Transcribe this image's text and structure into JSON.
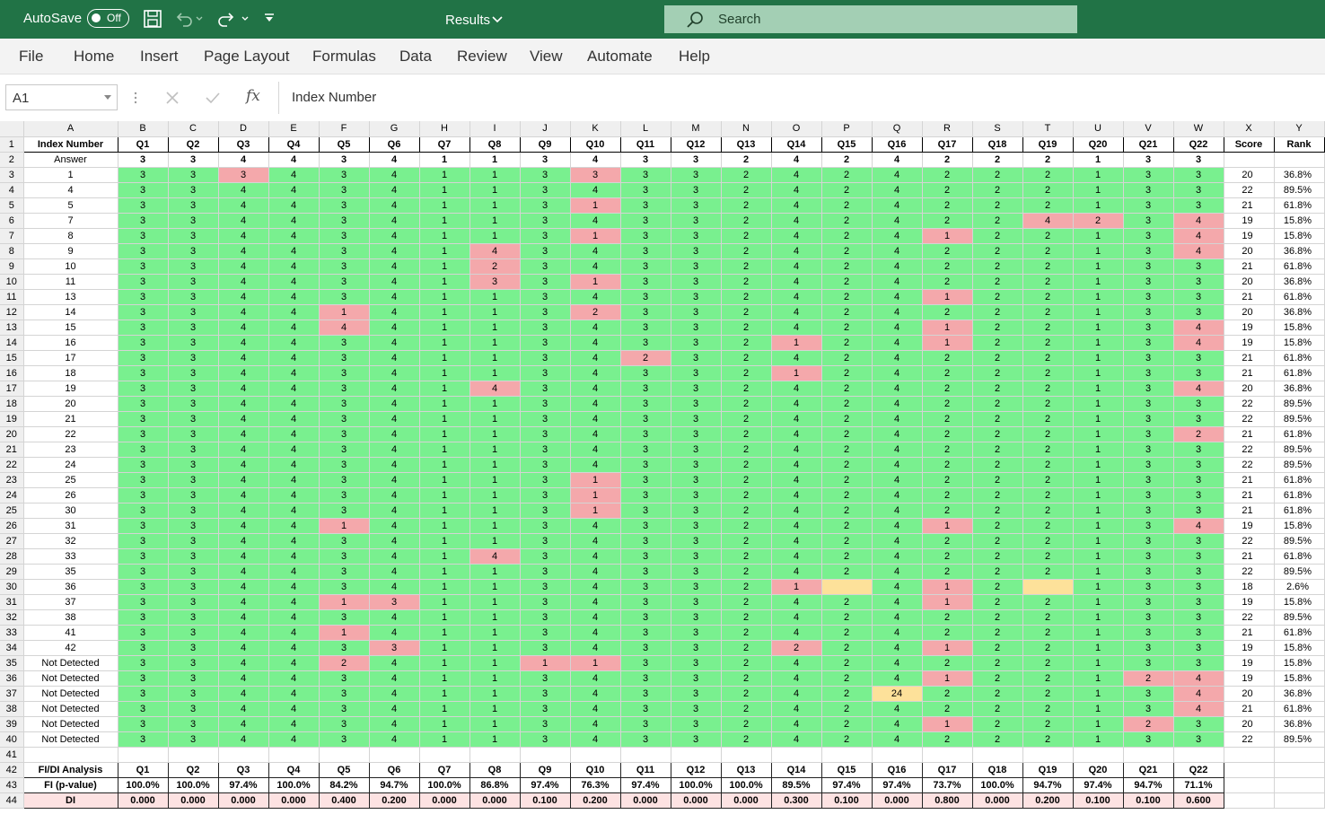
{
  "titlebar": {
    "autosave": "AutoSave",
    "toggle": "Off",
    "title": "Results",
    "search": "Search"
  },
  "ribbon": [
    "File",
    "Home",
    "Insert",
    "Page Layout",
    "Formulas",
    "Data",
    "Review",
    "View",
    "Automate",
    "Help"
  ],
  "formula": {
    "cell": "A1",
    "value": "Index Number"
  },
  "columns": [
    "A",
    "B",
    "C",
    "D",
    "E",
    "F",
    "G",
    "H",
    "I",
    "J",
    "K",
    "L",
    "M",
    "N",
    "O",
    "P",
    "Q",
    "R",
    "S",
    "T",
    "U",
    "V",
    "W",
    "X",
    "Y"
  ],
  "header": [
    "Index Number",
    "Q1",
    "Q2",
    "Q3",
    "Q4",
    "Q5",
    "Q6",
    "Q7",
    "Q8",
    "Q9",
    "Q10",
    "Q11",
    "Q12",
    "Q13",
    "Q14",
    "Q15",
    "Q16",
    "Q17",
    "Q18",
    "Q19",
    "Q20",
    "Q21",
    "Q22",
    "Score",
    "Rank"
  ],
  "answer": [
    "Answer",
    "3",
    "3",
    "4",
    "4",
    "3",
    "4",
    "1",
    "1",
    "3",
    "4",
    "3",
    "3",
    "2",
    "4",
    "2",
    "4",
    "2",
    "2",
    "2",
    "1",
    "3",
    "3"
  ],
  "students": [
    {
      "id": "1",
      "d": "3,3,3,4,3,4,1,1,3,3,3,3,2,4,2,4,2,2,2,1,3,3",
      "score": "20",
      "rank": "36.8%"
    },
    {
      "id": "4",
      "d": "3,3,4,4,3,4,1,1,3,4,3,3,2,4,2,4,2,2,2,1,3,3",
      "score": "22",
      "rank": "89.5%"
    },
    {
      "id": "5",
      "d": "3,3,4,4,3,4,1,1,3,1,3,3,2,4,2,4,2,2,2,1,3,3",
      "score": "21",
      "rank": "61.8%"
    },
    {
      "id": "7",
      "d": "3,3,4,4,3,4,1,1,3,4,3,3,2,4,2,4,2,2,4,2,3,4",
      "score": "19",
      "rank": "15.8%"
    },
    {
      "id": "8",
      "d": "3,3,4,4,3,4,1,1,3,1,3,3,2,4,2,4,1,2,2,1,3,4",
      "score": "19",
      "rank": "15.8%"
    },
    {
      "id": "9",
      "d": "3,3,4,4,3,4,1,4,3,4,3,3,2,4,2,4,2,2,2,1,3,4",
      "score": "20",
      "rank": "36.8%"
    },
    {
      "id": "10",
      "d": "3,3,4,4,3,4,1,2,3,4,3,3,2,4,2,4,2,2,2,1,3,3",
      "score": "21",
      "rank": "61.8%"
    },
    {
      "id": "11",
      "d": "3,3,4,4,3,4,1,3,3,1,3,3,2,4,2,4,2,2,2,1,3,3",
      "score": "20",
      "rank": "36.8%"
    },
    {
      "id": "13",
      "d": "3,3,4,4,3,4,1,1,3,4,3,3,2,4,2,4,1,2,2,1,3,3",
      "score": "21",
      "rank": "61.8%"
    },
    {
      "id": "14",
      "d": "3,3,4,4,1,4,1,1,3,2,3,3,2,4,2,4,2,2,2,1,3,3",
      "score": "20",
      "rank": "36.8%"
    },
    {
      "id": "15",
      "d": "3,3,4,4,4,4,1,1,3,4,3,3,2,4,2,4,1,2,2,1,3,4",
      "score": "19",
      "rank": "15.8%"
    },
    {
      "id": "16",
      "d": "3,3,4,4,3,4,1,1,3,4,3,3,2,1,2,4,1,2,2,1,3,4",
      "score": "19",
      "rank": "15.8%"
    },
    {
      "id": "17",
      "d": "3,3,4,4,3,4,1,1,3,4,2,3,2,4,2,4,2,2,2,1,3,3",
      "score": "21",
      "rank": "61.8%"
    },
    {
      "id": "18",
      "d": "3,3,4,4,3,4,1,1,3,4,3,3,2,1,2,4,2,2,2,1,3,3",
      "score": "21",
      "rank": "61.8%"
    },
    {
      "id": "19",
      "d": "3,3,4,4,3,4,1,4,3,4,3,3,2,4,2,4,2,2,2,1,3,4",
      "score": "20",
      "rank": "36.8%"
    },
    {
      "id": "20",
      "d": "3,3,4,4,3,4,1,1,3,4,3,3,2,4,2,4,2,2,2,1,3,3",
      "score": "22",
      "rank": "89.5%"
    },
    {
      "id": "21",
      "d": "3,3,4,4,3,4,1,1,3,4,3,3,2,4,2,4,2,2,2,1,3,3",
      "score": "22",
      "rank": "89.5%"
    },
    {
      "id": "22",
      "d": "3,3,4,4,3,4,1,1,3,4,3,3,2,4,2,4,2,2,2,1,3,2",
      "score": "21",
      "rank": "61.8%"
    },
    {
      "id": "23",
      "d": "3,3,4,4,3,4,1,1,3,4,3,3,2,4,2,4,2,2,2,1,3,3",
      "score": "22",
      "rank": "89.5%"
    },
    {
      "id": "24",
      "d": "3,3,4,4,3,4,1,1,3,4,3,3,2,4,2,4,2,2,2,1,3,3",
      "score": "22",
      "rank": "89.5%"
    },
    {
      "id": "25",
      "d": "3,3,4,4,3,4,1,1,3,1,3,3,2,4,2,4,2,2,2,1,3,3",
      "score": "21",
      "rank": "61.8%"
    },
    {
      "id": "26",
      "d": "3,3,4,4,3,4,1,1,3,1,3,3,2,4,2,4,2,2,2,1,3,3",
      "score": "21",
      "rank": "61.8%"
    },
    {
      "id": "30",
      "d": "3,3,4,4,3,4,1,1,3,1,3,3,2,4,2,4,2,2,2,1,3,3",
      "score": "21",
      "rank": "61.8%"
    },
    {
      "id": "31",
      "d": "3,3,4,4,1,4,1,1,3,4,3,3,2,4,2,4,1,2,2,1,3,4",
      "score": "19",
      "rank": "15.8%"
    },
    {
      "id": "32",
      "d": "3,3,4,4,3,4,1,1,3,4,3,3,2,4,2,4,2,2,2,1,3,3",
      "score": "22",
      "rank": "89.5%"
    },
    {
      "id": "33",
      "d": "3,3,4,4,3,4,1,4,3,4,3,3,2,4,2,4,2,2,2,1,3,3",
      "score": "21",
      "rank": "61.8%"
    },
    {
      "id": "35",
      "d": "3,3,4,4,3,4,1,1,3,4,3,3,2,4,2,4,2,2,2,1,3,3",
      "score": "22",
      "rank": "89.5%"
    },
    {
      "id": "36",
      "d": "3,3,4,4,3,4,1,1,3,4,3,3,2,1,,4,1,2,,1,3,3",
      "score": "18",
      "rank": "2.6%"
    },
    {
      "id": "37",
      "d": "3,3,4,4,1,3,1,1,3,4,3,3,2,4,2,4,1,2,2,1,3,3",
      "score": "19",
      "rank": "15.8%"
    },
    {
      "id": "38",
      "d": "3,3,4,4,3,4,1,1,3,4,3,3,2,4,2,4,2,2,2,1,3,3",
      "score": "22",
      "rank": "89.5%"
    },
    {
      "id": "41",
      "d": "3,3,4,4,1,4,1,1,3,4,3,3,2,4,2,4,2,2,2,1,3,3",
      "score": "21",
      "rank": "61.8%"
    },
    {
      "id": "42",
      "d": "3,3,4,4,3,3,1,1,3,4,3,3,2,2,2,4,1,2,2,1,3,3",
      "score": "19",
      "rank": "15.8%"
    },
    {
      "id": "Not Detected",
      "d": "3,3,4,4,2,4,1,1,1,1,3,3,2,4,2,4,2,2,2,1,3,3",
      "score": "19",
      "rank": "15.8%"
    },
    {
      "id": "Not Detected",
      "d": "3,3,4,4,3,4,1,1,3,4,3,3,2,4,2,4,1,2,2,1,2,4",
      "score": "19",
      "rank": "15.8%"
    },
    {
      "id": "Not Detected",
      "d": "3,3,4,4,3,4,1,1,3,4,3,3,2,4,2,24,2,2,2,1,3,4",
      "score": "20",
      "rank": "36.8%"
    },
    {
      "id": "Not Detected",
      "d": "3,3,4,4,3,4,1,1,3,4,3,3,2,4,2,4,2,2,2,1,3,4",
      "score": "21",
      "rank": "61.8%"
    },
    {
      "id": "Not Detected",
      "d": "3,3,4,4,3,4,1,1,3,4,3,3,2,4,2,4,1,2,2,1,2,3",
      "score": "20",
      "rank": "36.8%"
    },
    {
      "id": "Not Detected",
      "d": "3,3,4,4,3,4,1,1,3,4,3,3,2,4,2,4,2,2,2,1,3,3",
      "score": "22",
      "rank": "89.5%"
    }
  ],
  "analysis": {
    "label": "FI/DI Analysis",
    "fi_label": "FI (p-value)",
    "fi": [
      "100.0%",
      "100.0%",
      "97.4%",
      "100.0%",
      "84.2%",
      "94.7%",
      "100.0%",
      "86.8%",
      "97.4%",
      "76.3%",
      "97.4%",
      "100.0%",
      "100.0%",
      "89.5%",
      "97.4%",
      "97.4%",
      "73.7%",
      "100.0%",
      "94.7%",
      "97.4%",
      "94.7%",
      "71.1%"
    ],
    "di_label": "DI",
    "di": [
      "0.000",
      "0.000",
      "0.000",
      "0.000",
      "0.400",
      "0.200",
      "0.000",
      "0.000",
      "0.100",
      "0.200",
      "0.000",
      "0.000",
      "0.000",
      "0.300",
      "0.100",
      "0.000",
      "0.800",
      "0.000",
      "0.200",
      "0.100",
      "0.100",
      "0.600"
    ]
  },
  "colors": {
    "correct": "#79f08f",
    "wrong": "#f4a8ab",
    "blank": "#fde19a",
    "excel_green": "#217346"
  }
}
